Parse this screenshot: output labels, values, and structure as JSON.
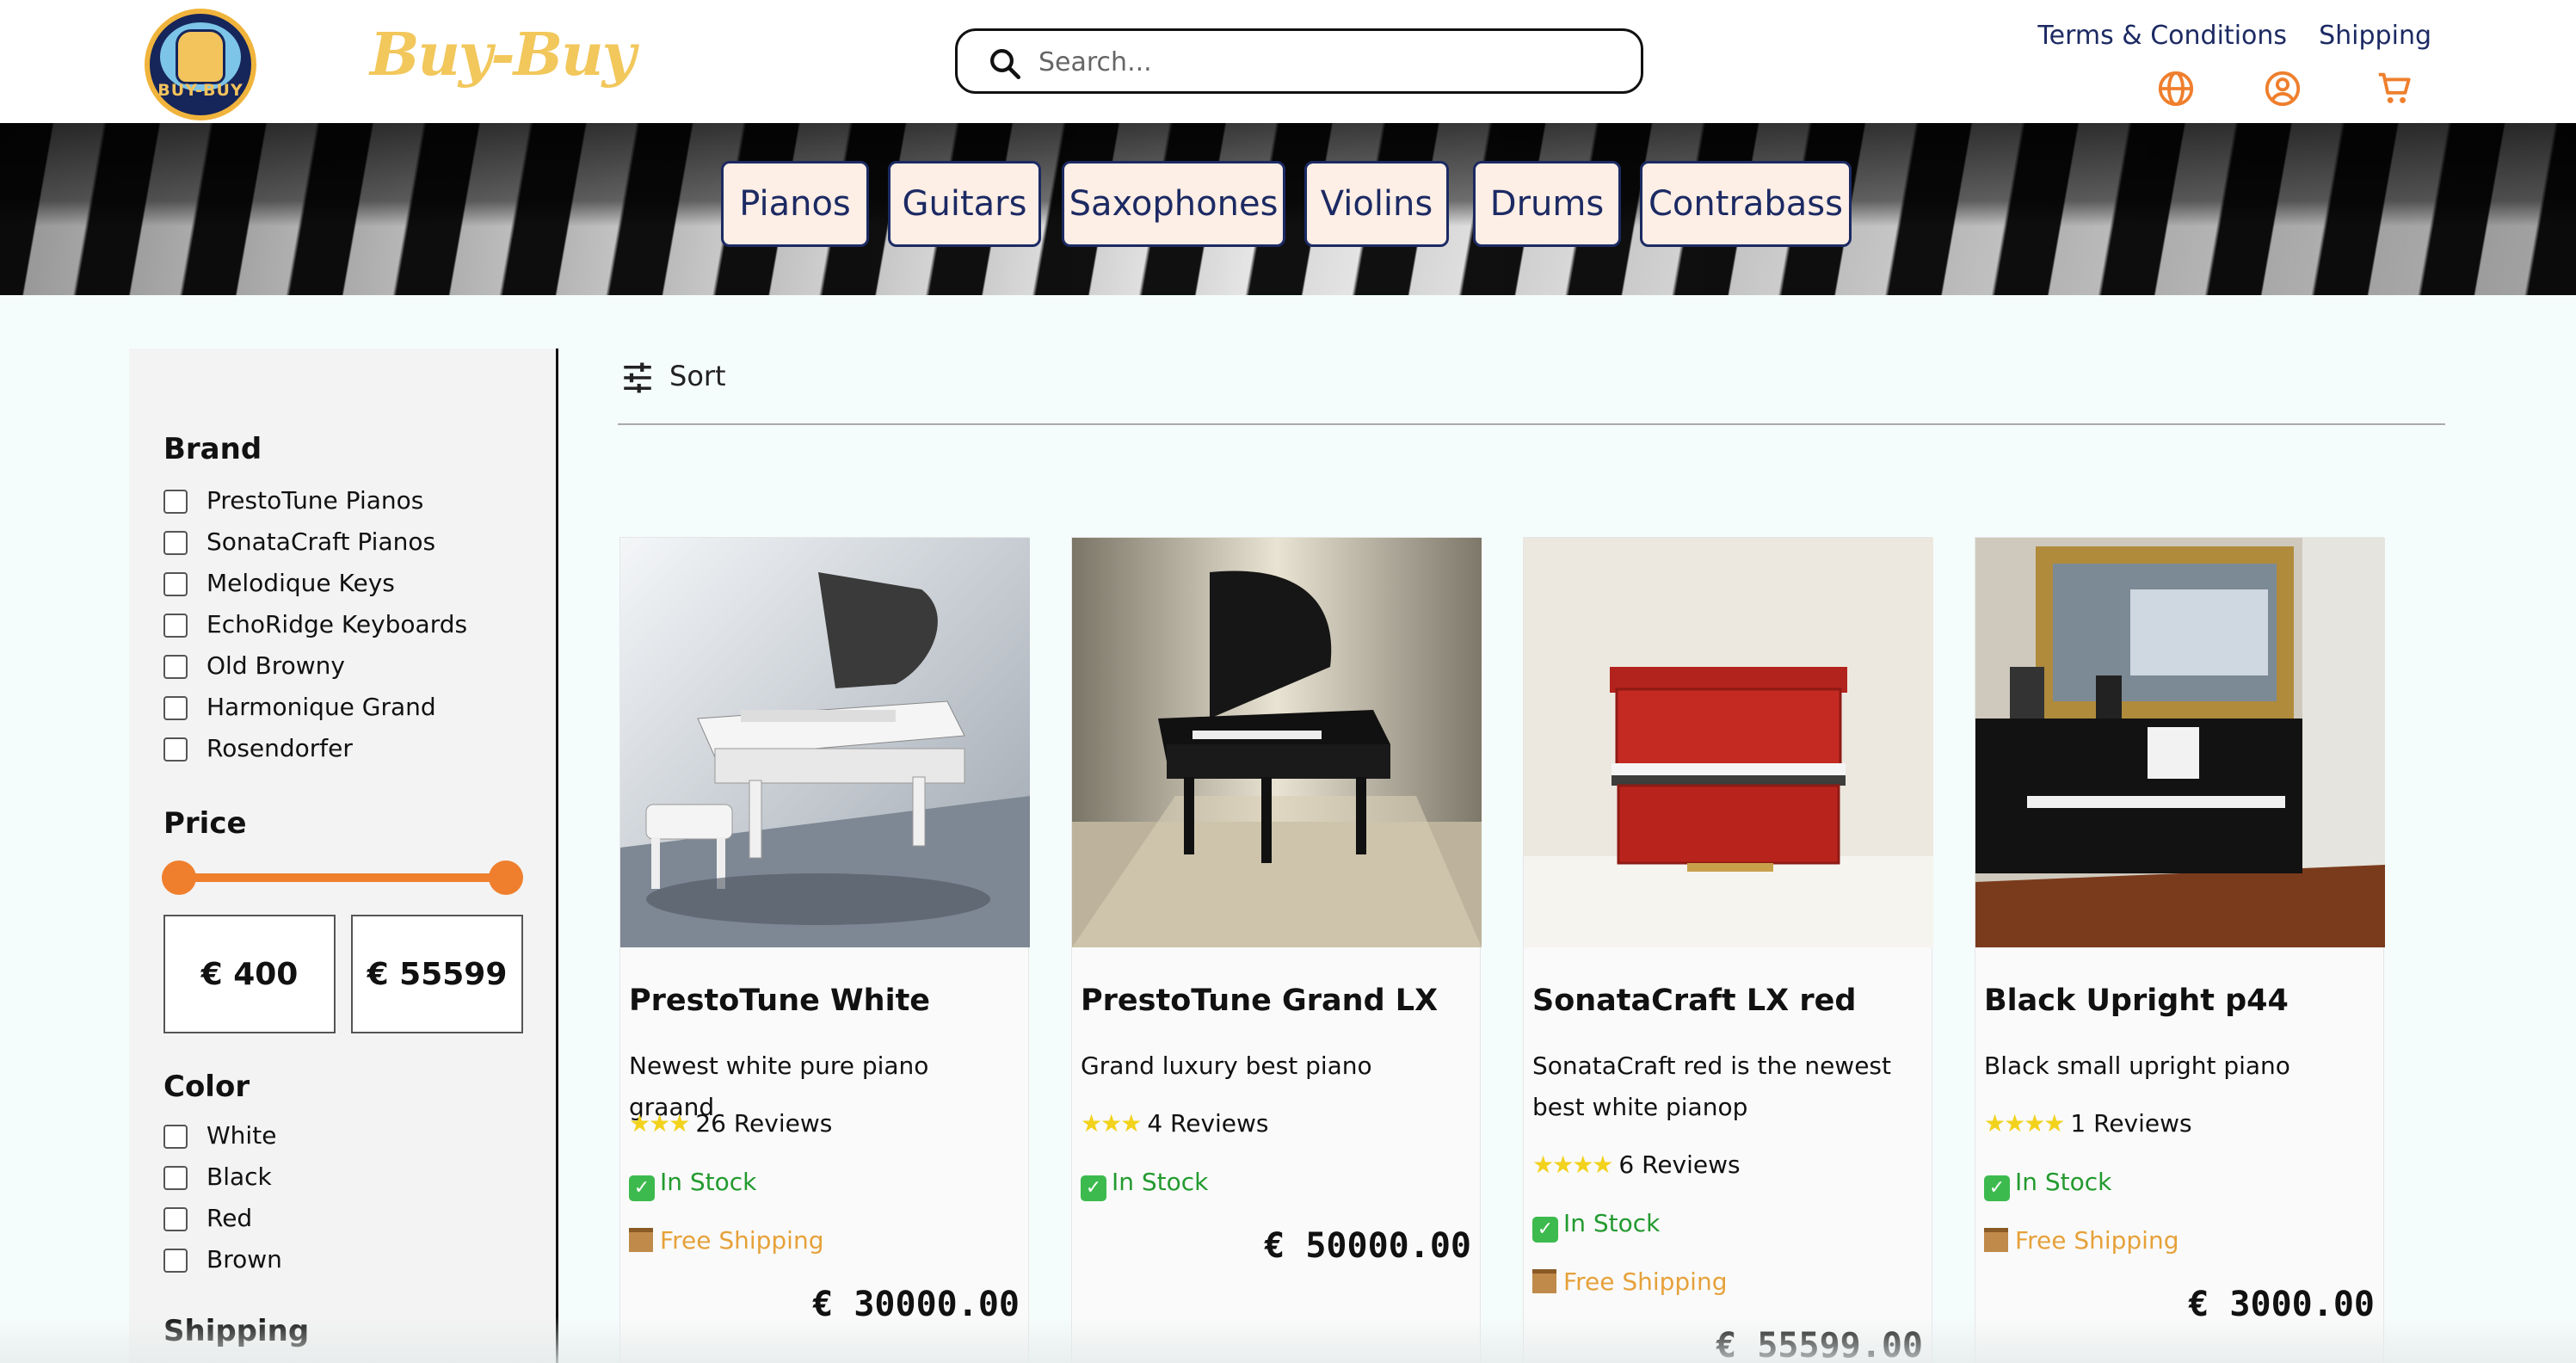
{
  "brand": {
    "logo_text": "BUY-BUY",
    "name": "Buy-Buy"
  },
  "search": {
    "placeholder": "Search..."
  },
  "header_links": [
    "Terms & Conditions",
    "Shipping"
  ],
  "header_icons": [
    "globe-icon",
    "user-icon",
    "cart-icon"
  ],
  "categories": [
    "Pianos",
    "Guitars",
    "Saxophones",
    "Violins",
    "Drums",
    "Contrabass"
  ],
  "filters": {
    "brand_title": "Brand",
    "brands": [
      "PrestoTune Pianos",
      "SonataCraft Pianos",
      "Melodique Keys",
      "EchoRidge Keyboards",
      "Old Browny",
      "Harmonique Grand",
      "Rosendorfer"
    ],
    "price_title": "Price",
    "price_min": "€ 400",
    "price_max": "€ 55599",
    "color_title": "Color",
    "colors": [
      "White",
      "Black",
      "Red",
      "Brown"
    ],
    "shipping_title": "Shipping"
  },
  "sort": {
    "label": "Sort"
  },
  "products": [
    {
      "title": "PrestoTune White",
      "desc": "Newest white pure piano graand",
      "stars": "★★★",
      "reviews": "26 Reviews",
      "stock": "In Stock",
      "shipping": "Free Shipping",
      "price": "€ 30000.00"
    },
    {
      "title": "PrestoTune Grand LX",
      "desc": "Grand luxury best piano",
      "stars": "★★★",
      "reviews": "4 Reviews",
      "stock": "In Stock",
      "shipping": "",
      "price": "€ 50000.00"
    },
    {
      "title": "SonataCraft LX red",
      "desc": "SonataCraft red is the newest best white pianop",
      "stars": "★★★★",
      "reviews": "6 Reviews",
      "stock": "In Stock",
      "shipping": "Free Shipping",
      "price": "€ 55599.00"
    },
    {
      "title": "Black Upright p44",
      "desc": "Black small upright piano",
      "stars": "★★★★",
      "reviews": "1 Reviews",
      "stock": "In Stock",
      "shipping": "Free Shipping",
      "price": "€ 3000.00"
    }
  ],
  "colors": {
    "accent": "#ef7f2d",
    "navy": "#1c2a63",
    "cat_bg": "#fdeee6",
    "in_stock": "#239a2f",
    "shipping": "#e6a13a",
    "brand_gold": "#f2c75b"
  }
}
